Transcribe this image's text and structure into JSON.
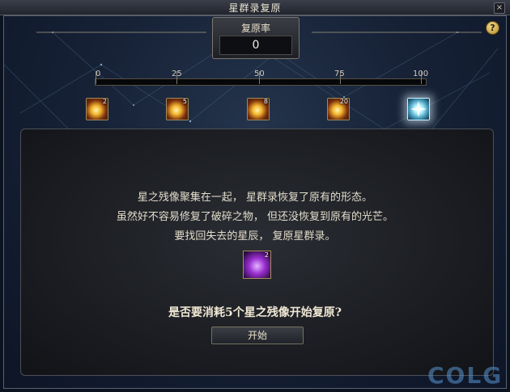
{
  "window": {
    "title": "星群录复原",
    "close_glyph": "×"
  },
  "help": {
    "glyph": "?"
  },
  "restore_rate": {
    "label": "复原率",
    "value": "0"
  },
  "progress": {
    "value": 0,
    "max": 100,
    "ticks": [
      "0",
      "25",
      "50",
      "75",
      "100"
    ]
  },
  "milestone_rewards": [
    {
      "count": "2",
      "icon": "sparkle-reward-icon"
    },
    {
      "count": "5",
      "icon": "sparkle-reward-icon"
    },
    {
      "count": "8",
      "icon": "sparkle-reward-icon"
    },
    {
      "count": "20",
      "icon": "sparkle-reward-icon"
    },
    {
      "count": "",
      "icon": "constellation-reward-icon"
    }
  ],
  "message": {
    "line1": "星之残像聚集在一起， 星群录恢复了原有的形态。",
    "line2": "虽然好不容易修复了破碎之物， 但还没恢复到原有的光芒。",
    "line3": "要找回失去的星辰， 复原星群录。"
  },
  "cost_item": {
    "count": "2",
    "icon": "star-afterimage-item-icon"
  },
  "question": "是否要消耗5个星之残像开始复原?",
  "start_button": {
    "label": "开始"
  },
  "watermark": "COLG"
}
